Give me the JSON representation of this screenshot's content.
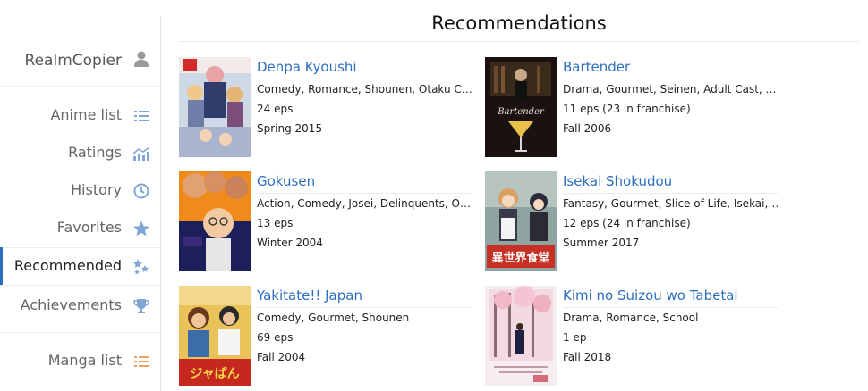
{
  "sidebar": {
    "user": {
      "name": "RealmCopier",
      "icon": "user-icon"
    },
    "items": [
      {
        "label": "Anime list",
        "icon": "list-icon",
        "active": false
      },
      {
        "label": "Ratings",
        "icon": "chart-icon",
        "active": false
      },
      {
        "label": "History",
        "icon": "history-icon",
        "active": false
      },
      {
        "label": "Favorites",
        "icon": "star-icon",
        "active": false
      },
      {
        "label": "Recommended",
        "icon": "recommend-icon",
        "active": true
      },
      {
        "label": "Achievements",
        "icon": "trophy-icon",
        "active": false
      },
      {
        "label": "Manga list",
        "icon": "manga-list-icon",
        "active": false
      }
    ]
  },
  "main": {
    "title": "Recommendations",
    "recommendations": [
      {
        "title": "Denpa Kyoushi",
        "genres": "Comedy, Romance, Shounen, Otaku Cu...",
        "episodes": "24 eps",
        "season": "Spring 2015"
      },
      {
        "title": "Bartender",
        "genres": "Drama, Gourmet, Seinen, Adult Cast, W...",
        "episodes": "11 eps (23 in franchise)",
        "season": "Fall 2006"
      },
      {
        "title": "Gokusen",
        "genres": "Action, Comedy, Josei, Delinquents, Org...",
        "episodes": "13 eps",
        "season": "Winter 2004"
      },
      {
        "title": "Isekai Shokudou",
        "genres": "Fantasy, Gourmet, Slice of Life, Isekai, ...",
        "episodes": "12 eps (24 in franchise)",
        "season": "Summer 2017"
      },
      {
        "title": "Yakitate!! Japan",
        "genres": "Comedy, Gourmet, Shounen",
        "episodes": "69 eps",
        "season": "Fall 2004"
      },
      {
        "title": "Kimi no Suizou wo Tabetai",
        "genres": "Drama, Romance, School",
        "episodes": "1 ep",
        "season": "Fall 2018"
      }
    ]
  },
  "colors": {
    "accent": "#2c6ebf",
    "icon": "#7fa6d6"
  }
}
